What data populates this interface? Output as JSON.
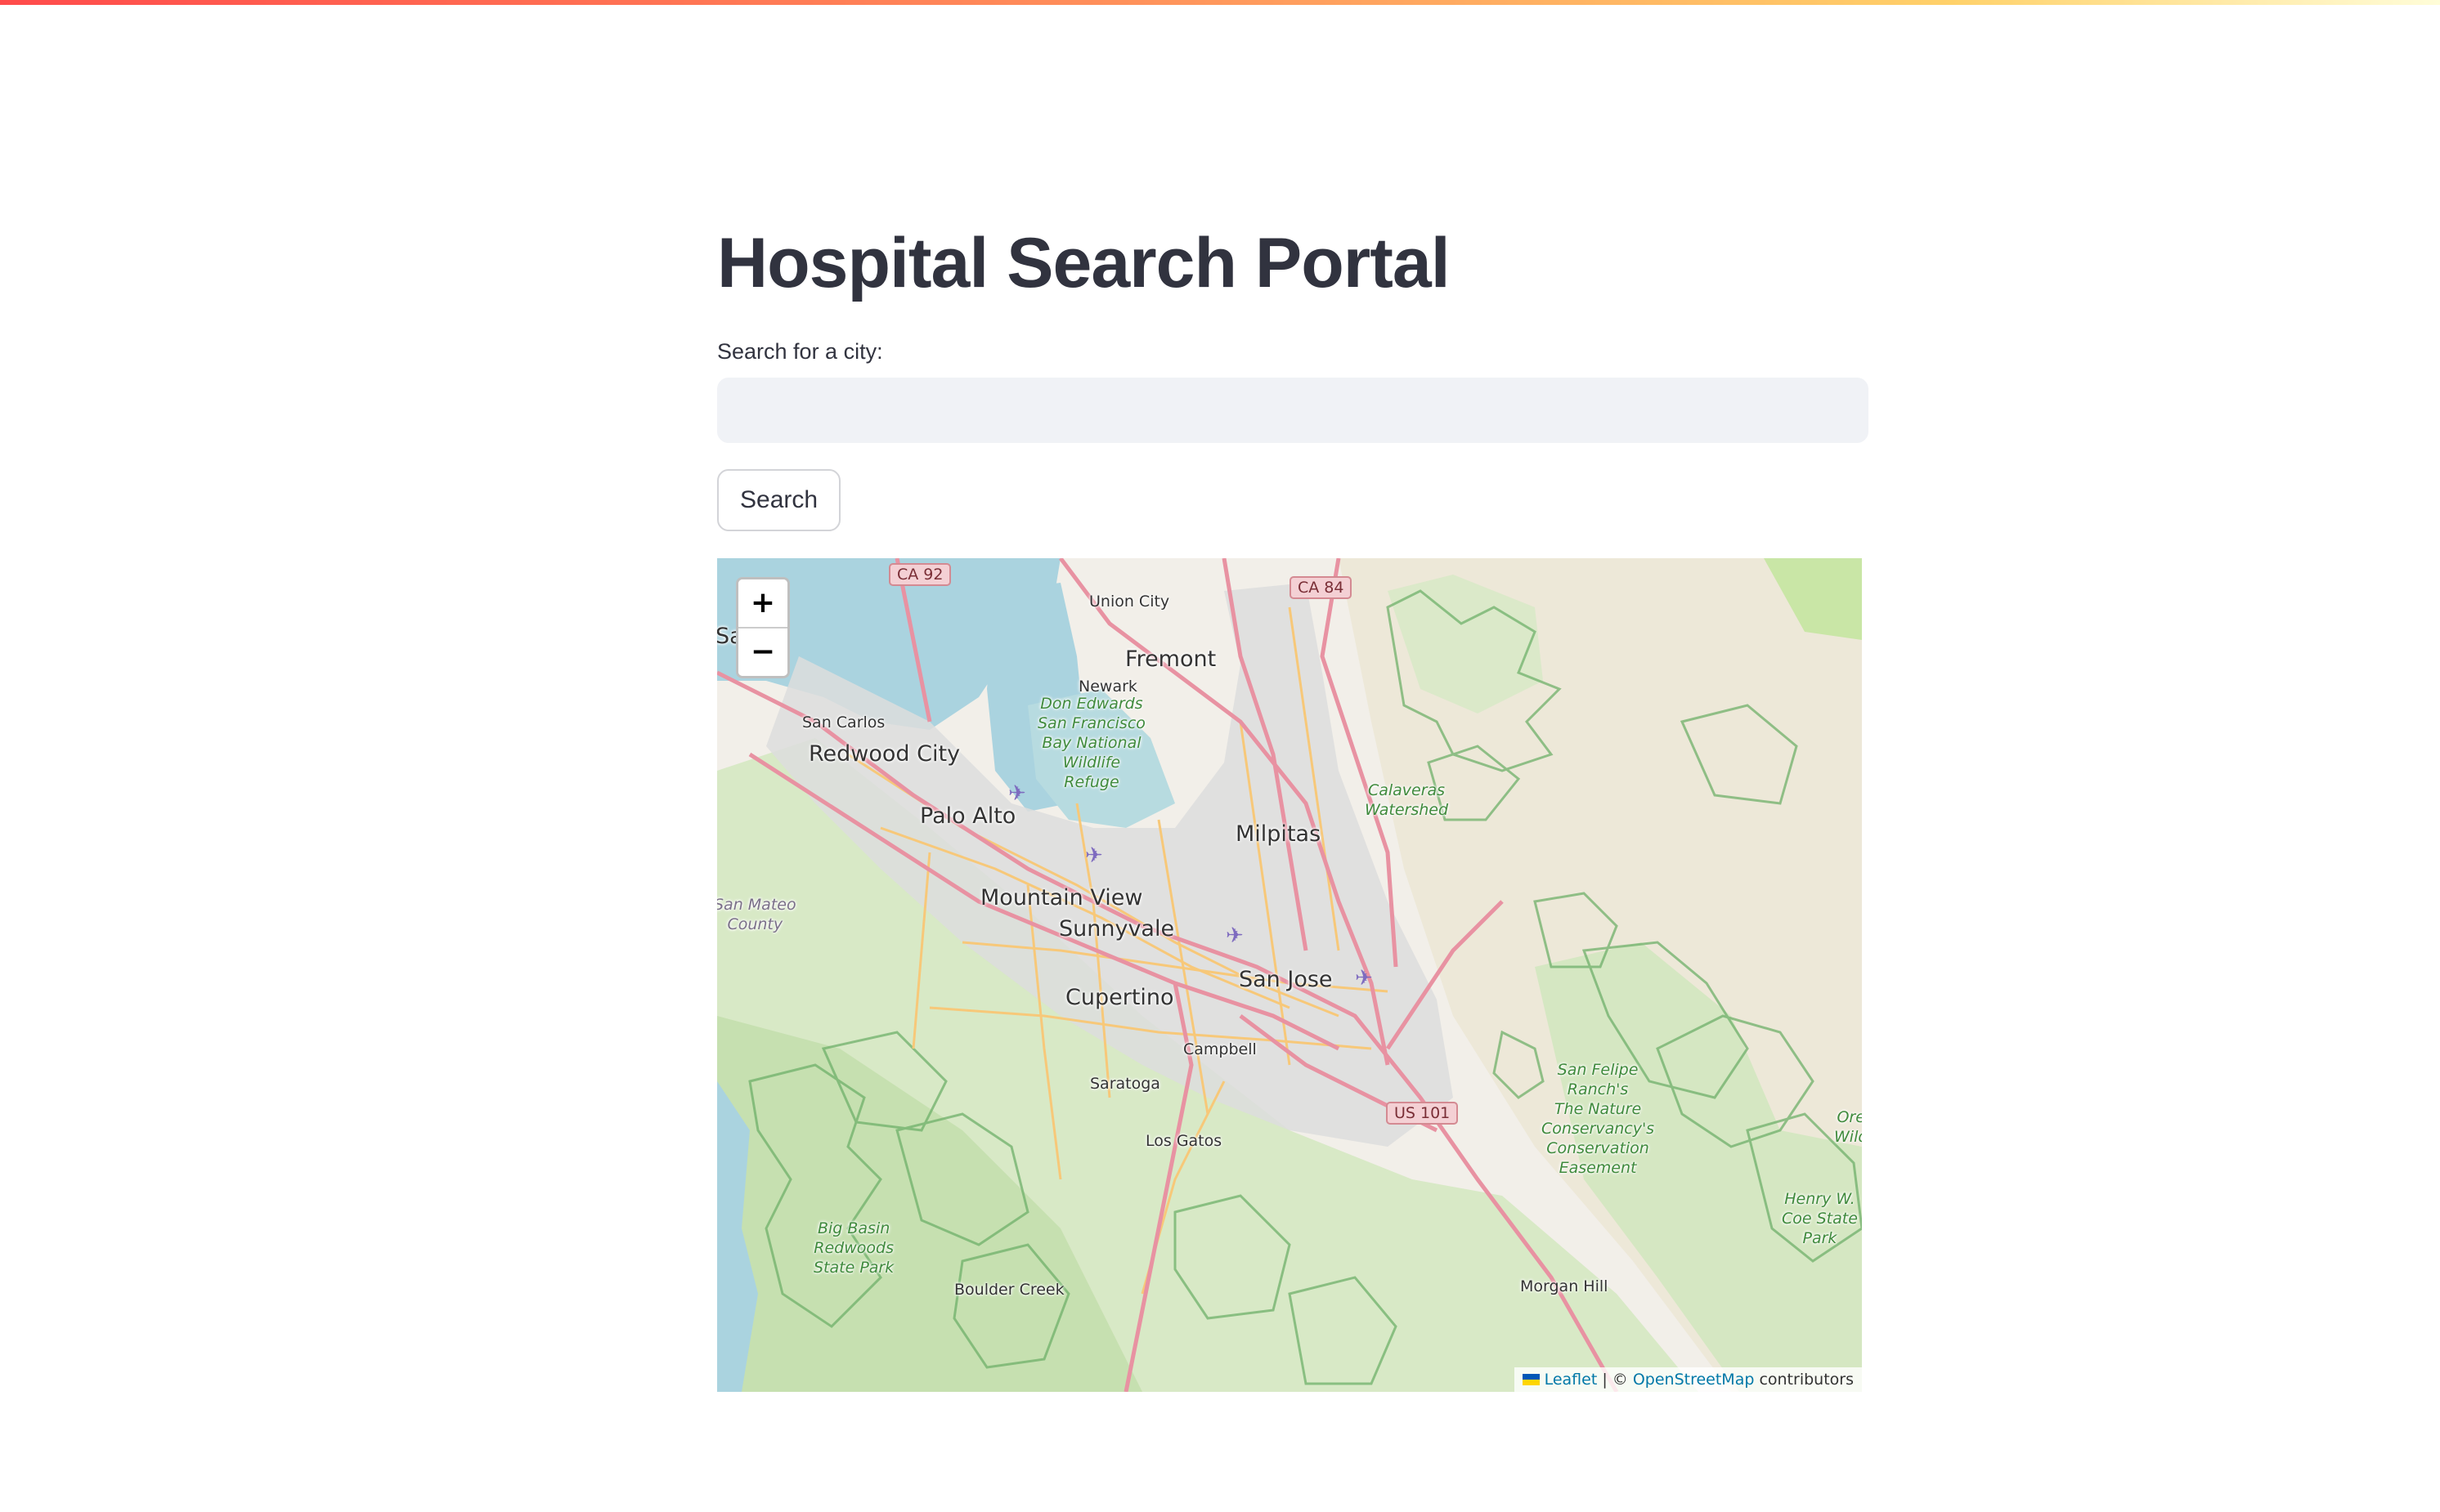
{
  "page": {
    "title": "Hospital Search Portal"
  },
  "search": {
    "label": "Search for a city:",
    "value": "",
    "placeholder": "",
    "button_label": "Search"
  },
  "map": {
    "zoom_in_label": "+",
    "zoom_out_label": "−",
    "attribution": {
      "leaflet": "Leaflet",
      "separator": " | © ",
      "osm": "OpenStreetMap",
      "suffix": " contributors"
    },
    "cities": {
      "union_city": "Union City",
      "fremont": "Fremont",
      "newark": "Newark",
      "san_carlos": "San Carlos",
      "redwood_city": "Redwood City",
      "palo_alto": "Palo Alto",
      "milpitas": "Milpitas",
      "mountain_view": "Mountain View",
      "sunnyvale": "Sunnyvale",
      "san_jose": "San Jose",
      "cupertino": "Cupertino",
      "campbell": "Campbell",
      "saratoga": "Saratoga",
      "los_gatos": "Los Gatos",
      "boulder_creek": "Boulder Creek",
      "morgan_hill": "Morgan Hill",
      "san_mateo_partial": "Sa   teo"
    },
    "parks": {
      "don_edwards": "Don Edwards\nSan Francisco\nBay National\nWildlife\nRefuge",
      "calaveras": "Calaveras\nWatershed",
      "san_felipe": "San Felipe\nRanch's\nThe Nature\nConservancy's\nConservation\nEasement",
      "henry_coe": "Henry W.\nCoe State\nPark",
      "big_basin": "Big Basin\nRedwoods\nState Park",
      "edge_partial": "Ore\nWild"
    },
    "county": "San Mateo\nCounty",
    "shields": {
      "ca92": "CA 92",
      "ca84": "CA 84",
      "us101": "US 101"
    },
    "icons": {
      "zoom_in": "plus-icon",
      "zoom_out": "minus-icon",
      "airport": "airport-icon",
      "flag": "ukraine-flag-icon"
    },
    "colors": {
      "water": "#aad3df",
      "land": "#f2efe9",
      "park": "#cde6b8",
      "urban": "#dcdcdc",
      "road_major": "#e892a2",
      "road_minor": "#f7c879",
      "boundary": "#6fb06a"
    }
  }
}
